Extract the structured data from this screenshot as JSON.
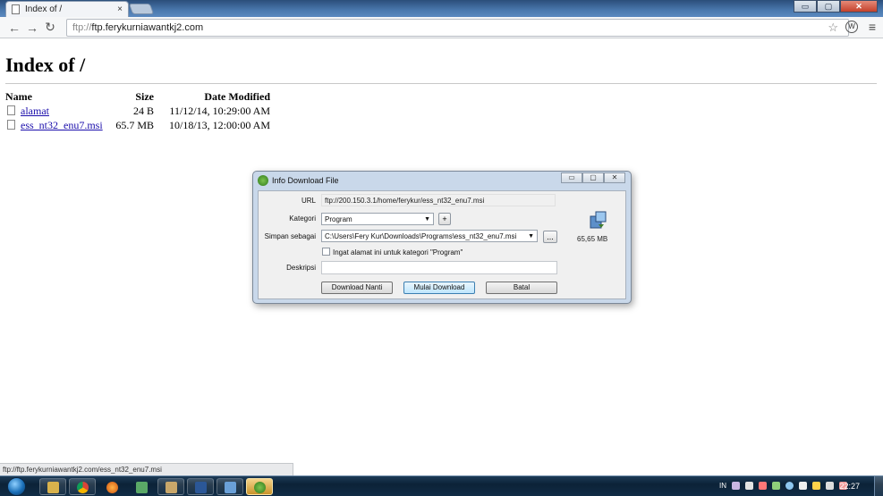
{
  "browser": {
    "tab_title": "Index of /",
    "tab_close": "×",
    "url_scheme": "ftp://",
    "url_host": "ftp.ferykurniawantkj2.com",
    "window_controls": {
      "minimize": "▭",
      "maximize": "▢",
      "close": "✕"
    }
  },
  "page": {
    "title": "Index of /",
    "columns": {
      "name": "Name",
      "size": "Size",
      "date": "Date Modified"
    },
    "rows": [
      {
        "name": "alamat",
        "size": "24 B",
        "date": "11/12/14, 10:29:00 AM"
      },
      {
        "name": "ess_nt32_enu7.msi",
        "size": "65.7 MB",
        "date": "10/18/13, 12:00:00 AM"
      }
    ]
  },
  "dialog": {
    "title": "Info Download File",
    "url_label": "URL",
    "url_value": "ftp://200.150.3.1/home/ferykur/ess_nt32_enu7.msi",
    "kategori_label": "Kategori",
    "kategori_value": "Program",
    "add_button": "+",
    "save_label": "Simpan sebagai",
    "save_value": "C:\\Users\\Fery Kur\\Downloads\\Programs\\ess_nt32_enu7.msi",
    "browse_button": "...",
    "remember_label": "Ingat alamat ini untuk kategori \"Program\"",
    "remember_checked": false,
    "deskripsi_label": "Deskripsi",
    "deskripsi_value": "",
    "file_size": "65,65 MB",
    "buttons": {
      "later": "Download Nanti",
      "start": "Mulai Download",
      "cancel": "Batal"
    }
  },
  "status_bar": {
    "text": "ftp://ftp.ferykurniawantkj2.com/ess_nt32_enu7.msi"
  },
  "taskbar": {
    "language": "IN",
    "clock": "22:27"
  },
  "colors": {
    "link": "#1a0dab",
    "dialog_frame": "#c9d8ea",
    "taskbar": "#0c2237"
  }
}
